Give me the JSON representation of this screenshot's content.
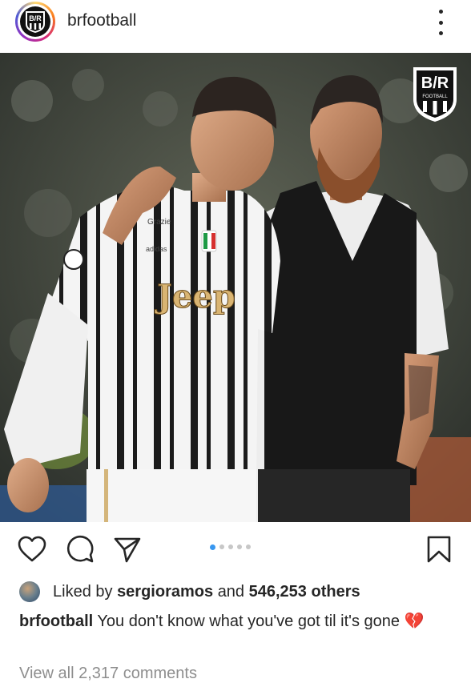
{
  "post": {
    "username": "brfootball",
    "avatar_text": "B/R",
    "watermark": {
      "line1": "B/R",
      "line2": "FOOTBALL"
    },
    "carousel": {
      "count": 5,
      "active_index": 0
    }
  },
  "photo": {
    "jersey_sponsor": "Jeep",
    "sleeve_sponsor": "Grazie",
    "kit_brand": "adidas"
  },
  "actions": {
    "like_icon": "heart-icon",
    "comment_icon": "comment-icon",
    "share_icon": "share-icon",
    "save_icon": "bookmark-icon"
  },
  "likes": {
    "prefix": "Liked by",
    "liker": "sergioramos",
    "middle": "and",
    "count_text": "546,253 others"
  },
  "caption": {
    "handle": "brfootball",
    "text": "You don't know what you've got til it's gone",
    "emoji": "💔"
  },
  "comments": {
    "label": "View all 2,317 comments"
  },
  "colors": {
    "accent": "#3897f0",
    "text": "#262626",
    "muted": "#8e8e8e"
  }
}
